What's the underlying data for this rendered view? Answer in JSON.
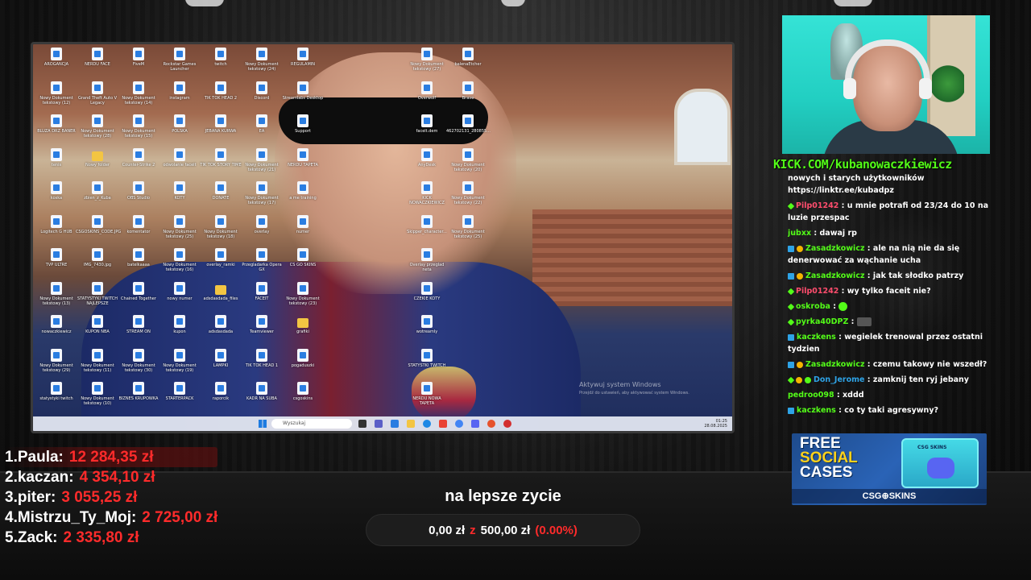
{
  "kick": {
    "url": "KICK.COM/kubanowaczkiewicz"
  },
  "desktop": {
    "icons": [
      {
        "label": "AROGANCJA",
        "type": "file"
      },
      {
        "label": "Nowy Dokument tekstowy (12)",
        "type": "file"
      },
      {
        "label": "BLUZA DRZ BANER",
        "type": "file"
      },
      {
        "label": "tenis",
        "type": "file"
      },
      {
        "label": "koska",
        "type": "file"
      },
      {
        "label": "Logitech G HUB",
        "type": "file"
      },
      {
        "label": "TVP ULTRE",
        "type": "file"
      },
      {
        "label": "Nowy Dokument tekstowy (13)",
        "type": "file"
      },
      {
        "label": "nowaczkiewicz",
        "type": "file"
      },
      {
        "label": "Nowy Dokument tekstowy (29)",
        "type": "file"
      },
      {
        "label": "statystyki twitch",
        "type": "file"
      },
      {
        "label": "NERDU FACE",
        "type": "file"
      },
      {
        "label": "Grand Theft Auto V Legacy",
        "type": "file"
      },
      {
        "label": "Nowy Dokument tekstowy (28)",
        "type": "file"
      },
      {
        "label": "Nowy folder",
        "type": "folder"
      },
      {
        "label": "zbien_z_Kuba",
        "type": "file"
      },
      {
        "label": "CSGOSKINS_CODE.JPG",
        "type": "file"
      },
      {
        "label": "IMG_7430.jpg",
        "type": "file"
      },
      {
        "label": "STATYSTYKI TWITCH NAJLEPSZE",
        "type": "file"
      },
      {
        "label": "KUPON NBA",
        "type": "file"
      },
      {
        "label": "Nowy Dokument tekstowy (11)",
        "type": "file"
      },
      {
        "label": "Nowy Dokument tekstowy (10)",
        "type": "file"
      },
      {
        "label": "FiveM",
        "type": "file"
      },
      {
        "label": "Nowy Dokument tekstowy (14)",
        "type": "file"
      },
      {
        "label": "Nowy Dokument tekstowy (15)",
        "type": "file"
      },
      {
        "label": "Counter-Strike 2",
        "type": "file"
      },
      {
        "label": "OBS Studio",
        "type": "file"
      },
      {
        "label": "komentator",
        "type": "file"
      },
      {
        "label": "batelkaaaa",
        "type": "file"
      },
      {
        "label": "Chained Together",
        "type": "file"
      },
      {
        "label": "STREAM ON",
        "type": "file"
      },
      {
        "label": "Nowy Dokument tekstowy (30)",
        "type": "file"
      },
      {
        "label": "BIZNES KRUPOWKA",
        "type": "file"
      },
      {
        "label": "Rockstar Games Launcher",
        "type": "file"
      },
      {
        "label": "instagram",
        "type": "file"
      },
      {
        "label": "POLSKA",
        "type": "file"
      },
      {
        "label": "odwolanie faceit",
        "type": "file"
      },
      {
        "label": "KOTY",
        "type": "file"
      },
      {
        "label": "Nowy Dokument tekstowy (25)",
        "type": "file"
      },
      {
        "label": "Nowy Dokument tekstowy (16)",
        "type": "file"
      },
      {
        "label": "nowy numer",
        "type": "file"
      },
      {
        "label": "kupon",
        "type": "file"
      },
      {
        "label": "Nowy Dokument tekstowy (19)",
        "type": "file"
      },
      {
        "label": "STARTERPACK",
        "type": "file"
      },
      {
        "label": "twitch",
        "type": "file"
      },
      {
        "label": "TIK TOK HEAD 2",
        "type": "file"
      },
      {
        "label": "JEBANA KURWA",
        "type": "file"
      },
      {
        "label": "TIK TOK STORY TIME",
        "type": "file"
      },
      {
        "label": "DONATE",
        "type": "file"
      },
      {
        "label": "Nowy Dokument tekstowy (18)",
        "type": "file"
      },
      {
        "label": "overlay_ramki",
        "type": "file"
      },
      {
        "label": "adsdasdada_files",
        "type": "folder"
      },
      {
        "label": "adsdasdada",
        "type": "file"
      },
      {
        "label": "LAMPKI",
        "type": "file"
      },
      {
        "label": "raporcik",
        "type": "file"
      },
      {
        "label": "Nowy Dokument tekstowy (24)",
        "type": "file"
      },
      {
        "label": "Discord",
        "type": "file"
      },
      {
        "label": "EA",
        "type": "file"
      },
      {
        "label": "Nowy Dokument tekstowy (21)",
        "type": "file"
      },
      {
        "label": "Nowy Dokument tekstowy (17)",
        "type": "file"
      },
      {
        "label": "overlay",
        "type": "file"
      },
      {
        "label": "Przegladarka Opera GX",
        "type": "file"
      },
      {
        "label": "FACEIT",
        "type": "file"
      },
      {
        "label": "Teamviewer",
        "type": "file"
      },
      {
        "label": "TIK TOK HEAD 1",
        "type": "file"
      },
      {
        "label": "KADR NA SUBA",
        "type": "file"
      },
      {
        "label": "REGULAMIN",
        "type": "file"
      },
      {
        "label": "Streamlabs Desktop",
        "type": "file"
      },
      {
        "label": "Support",
        "type": "file"
      },
      {
        "label": "NERDU TAPETA",
        "type": "file"
      },
      {
        "label": "a me training",
        "type": "file"
      },
      {
        "label": "numer",
        "type": "file"
      },
      {
        "label": "CS GO SKINS",
        "type": "file"
      },
      {
        "label": "Nowy Dokument tekstowy (23)",
        "type": "file"
      },
      {
        "label": "grafiki",
        "type": "folder"
      },
      {
        "label": "pogaduszki",
        "type": "file"
      },
      {
        "label": "csgoskins",
        "type": "file"
      },
      {
        "label": "Nowy Dokument tekstowy (27)",
        "type": "file"
      },
      {
        "label": "Overwolf",
        "type": "file"
      },
      {
        "label": "facelt.dem",
        "type": "file"
      },
      {
        "label": "AnyDesk",
        "type": "file"
      },
      {
        "label": "KICK NOWACZKIEWICZ",
        "type": "file"
      },
      {
        "label": "Skipper_character...",
        "type": "file"
      },
      {
        "label": "Overlay przeglad neta",
        "type": "file"
      },
      {
        "label": "CZEKIE KOTY",
        "type": "file"
      },
      {
        "label": "wotreamly",
        "type": "file"
      },
      {
        "label": "STATYSTKI TWITCH",
        "type": "file"
      },
      {
        "label": "NERDU NOWA TAPETA",
        "type": "file"
      },
      {
        "label": "balenaEtcher",
        "type": "file"
      },
      {
        "label": "Brave",
        "type": "file"
      },
      {
        "label": "462702131_280855...",
        "type": "file"
      },
      {
        "label": "Nowy Dokument tekstowy (20)",
        "type": "file"
      },
      {
        "label": "Nowy Dokument tekstowy (22)",
        "type": "file"
      },
      {
        "label": "Nowy Dokument tekstowy (25)",
        "type": "file"
      }
    ],
    "watermark_title": "Aktywuj system Windows",
    "watermark_sub": "Przejdź do ustawień, aby aktywować system Windows.",
    "taskbar": {
      "search_placeholder": "Wyszukaj",
      "time": "01:25",
      "date": "28.08.2025"
    }
  },
  "chat": {
    "messages": [
      {
        "badges": [],
        "user": "",
        "user_color": "#ffffff",
        "text": "nowych i starych użytkowników https://linktr.ee/kubadpz"
      },
      {
        "badges": [
          "vip"
        ],
        "user": "Pilp01242",
        "user_color": "#ff4d6d",
        "text": "u mnie potrafi od 23/24 do 10 na luzie przespac"
      },
      {
        "badges": [],
        "user": "jubxx",
        "user_color": "#53fc18",
        "text": "dawaj rp"
      },
      {
        "badges": [
          "mod",
          "sub"
        ],
        "user": "Zasadzkowicz",
        "user_color": "#53fc18",
        "text": "ale na nią nie da się denerwować za wąchanie ucha"
      },
      {
        "badges": [
          "mod",
          "sub"
        ],
        "user": "Zasadzkowicz",
        "user_color": "#53fc18",
        "text": "jak tak słodko patrzy"
      },
      {
        "badges": [
          "vip"
        ],
        "user": "Pilp01242",
        "user_color": "#ff4d6d",
        "text": "wy tylko faceit nie?"
      },
      {
        "badges": [
          "vip"
        ],
        "user": "oskroba",
        "user_color": "#53fc18",
        "text": "",
        "emote": "green"
      },
      {
        "badges": [
          "vip"
        ],
        "user": "pyrka40DPZ",
        "user_color": "#53fc18",
        "text": "",
        "emote": "sad"
      },
      {
        "badges": [
          "mod"
        ],
        "user": "kaczkens",
        "user_color": "#53fc18",
        "text": "wegielek trenowal przez ostatni tydzien"
      },
      {
        "badges": [
          "mod",
          "sub"
        ],
        "user": "Zasadzkowicz",
        "user_color": "#53fc18",
        "text": "czemu takowy nie wszedł?"
      },
      {
        "badges": [
          "vip",
          "sub",
          "green"
        ],
        "user": "Don_Jerome",
        "user_color": "#2ea3e6",
        "text": "zamknij ten ryj jebany"
      },
      {
        "badges": [],
        "user": "pedroo098",
        "user_color": "#53fc18",
        "text": "xddd"
      },
      {
        "badges": [
          "mod"
        ],
        "user": "kaczkens",
        "user_color": "#53fc18",
        "text": "co ty taki agresywny?"
      }
    ]
  },
  "promo": {
    "line1": "FREE",
    "line2": "SOCIAL",
    "line3": "CASES",
    "box_label": "CSG SKINS",
    "brand": "CSG⊕SKINS"
  },
  "leaderboard": [
    {
      "rank": "1.",
      "name": "Paula:",
      "amount": "12 284,35 zł"
    },
    {
      "rank": "2.",
      "name": "kaczan:",
      "amount": "4 354,10 zł"
    },
    {
      "rank": "3.",
      "name": "piter:",
      "amount": "3 055,25 zł"
    },
    {
      "rank": "4.",
      "name": "Mistrzu_Ty_Moj:",
      "amount": "2 725,00 zł"
    },
    {
      "rank": "5.",
      "name": "Zack:",
      "amount": "2 335,80 zł"
    }
  ],
  "goal": {
    "title": "na lepsze zycie",
    "current": "0,00 zł",
    "separator": "z",
    "target": "500,00 zł",
    "percent": "(0.00%)",
    "fraction": 0.0
  },
  "colors": {
    "accent_green": "#53fc18",
    "accent_red": "#ff2b2b"
  }
}
